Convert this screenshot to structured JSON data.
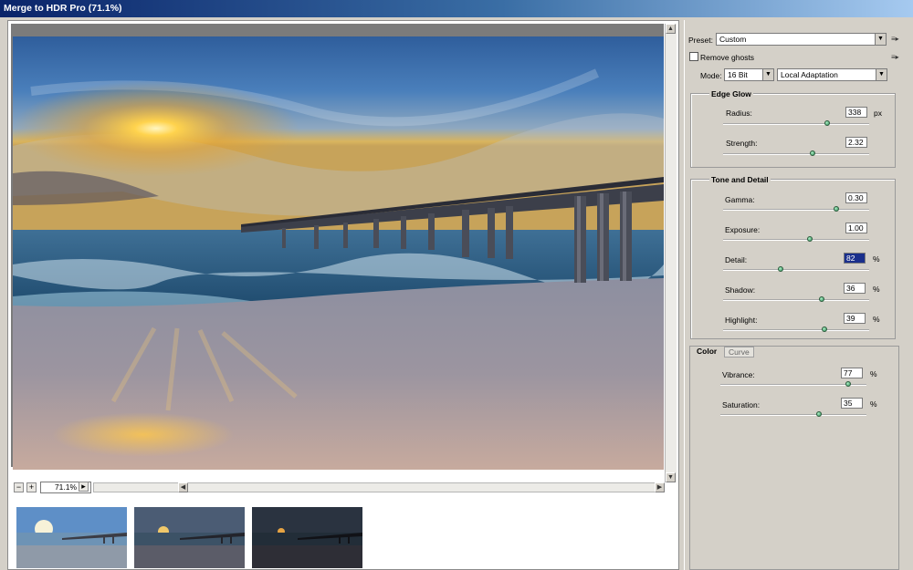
{
  "window": {
    "title": "Merge to HDR Pro (71.1%)"
  },
  "preview": {
    "zoom": "71.1%",
    "zoom_out_label": "−",
    "zoom_in_label": "+",
    "zoom_menu_arrow": "▸",
    "scroll_up": "▲",
    "scroll_down": "▼",
    "scroll_left": "◀",
    "scroll_right": "▶"
  },
  "settings": {
    "preset_label": "Preset:",
    "preset_value": "Custom",
    "remove_ghosts_label": "Remove ghosts",
    "remove_ghosts_checked": false,
    "mode_label": "Mode:",
    "bit_depth": "16 Bit",
    "method": "Local Adaptation",
    "arrow_glyph": "▼",
    "menu_glyph": "≡▸"
  },
  "edge_glow": {
    "title": "Edge Glow",
    "radius": {
      "label": "Radius:",
      "value": "338",
      "unit": "px",
      "position": 0.72
    },
    "strength": {
      "label": "Strength:",
      "value": "2.32",
      "unit": "",
      "position": 0.62
    }
  },
  "tone_detail": {
    "title": "Tone and Detail",
    "gamma": {
      "label": "Gamma:",
      "value": "0.30",
      "unit": "",
      "position": 0.78
    },
    "exposure": {
      "label": "Exposure:",
      "value": "1.00",
      "unit": "",
      "position": 0.6
    },
    "detail": {
      "label": "Detail:",
      "value": "82",
      "unit": "%",
      "position": 0.4
    },
    "shadow": {
      "label": "Shadow:",
      "value": "36",
      "unit": "%",
      "position": 0.68
    },
    "highlight": {
      "label": "Highlight:",
      "value": "39",
      "unit": "%",
      "position": 0.7
    }
  },
  "color_tabs": {
    "active": "Color",
    "inactive": "Curve",
    "vibrance": {
      "label": "Vibrance:",
      "value": "77",
      "unit": "%",
      "position": 0.88
    },
    "saturation": {
      "label": "Saturation:",
      "value": "35",
      "unit": "%",
      "position": 0.68
    }
  },
  "colors": {
    "titlebar_start": "#0a246a",
    "panel_bg": "#d4d0c8",
    "selected_field": "#1a2f8c"
  }
}
